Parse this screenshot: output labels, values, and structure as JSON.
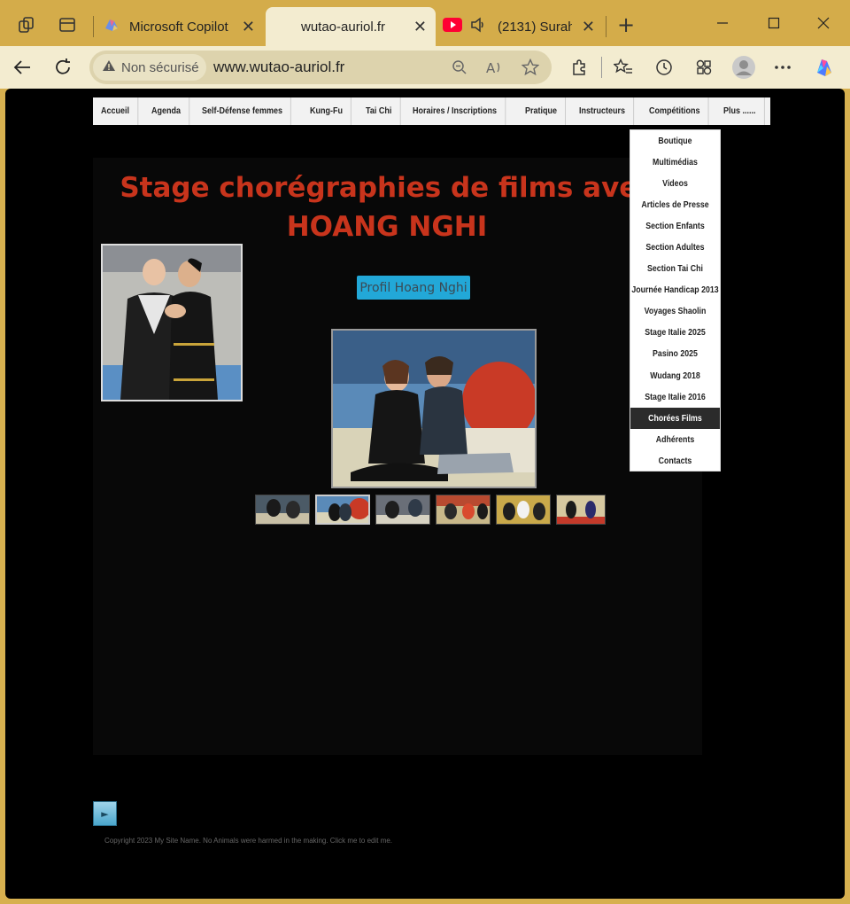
{
  "browser": {
    "tabs": [
      {
        "title": "Microsoft Copilot"
      },
      {
        "title": "wutao-auriol.fr"
      },
      {
        "title": "(2131) Surah"
      }
    ],
    "security_label": "Non sécurisé",
    "url": "www.wutao-auriol.fr"
  },
  "site": {
    "nav": [
      "Accueil",
      "Agenda",
      "Self-Défense femmes",
      "Kung-Fu",
      "Tai Chi",
      "Horaires / Inscriptions",
      "Pratique",
      "Instructeurs",
      "Compétitions",
      "Plus ......"
    ],
    "dropdown": [
      "Boutique",
      "Multimédias",
      "Videos",
      "Articles de Presse",
      "Section Enfants",
      "Section Adultes",
      "Section Tai Chi",
      "Journée Handicap 2013",
      "Voyages Shaolin",
      "Stage Italie 2025",
      "Pasino 2025",
      "Wudang 2018",
      "Stage Italie 2016",
      "Chorées Films",
      "Adhérents",
      "Contacts"
    ],
    "dropdown_active_index": 13,
    "page_title_line1": "Stage chorégraphies de films avec",
    "page_title_line2": "HOANG NGHI",
    "profile_button": "Profil Hoang Nghi",
    "play_button": "►",
    "copyright": "Copyright 2023 My Site Name. No Animals were harmed in the making. Click me to edit me."
  },
  "colors": {
    "title": "#c8341c",
    "button": "#22a8d8",
    "tabbar": "#d4ac4a"
  }
}
